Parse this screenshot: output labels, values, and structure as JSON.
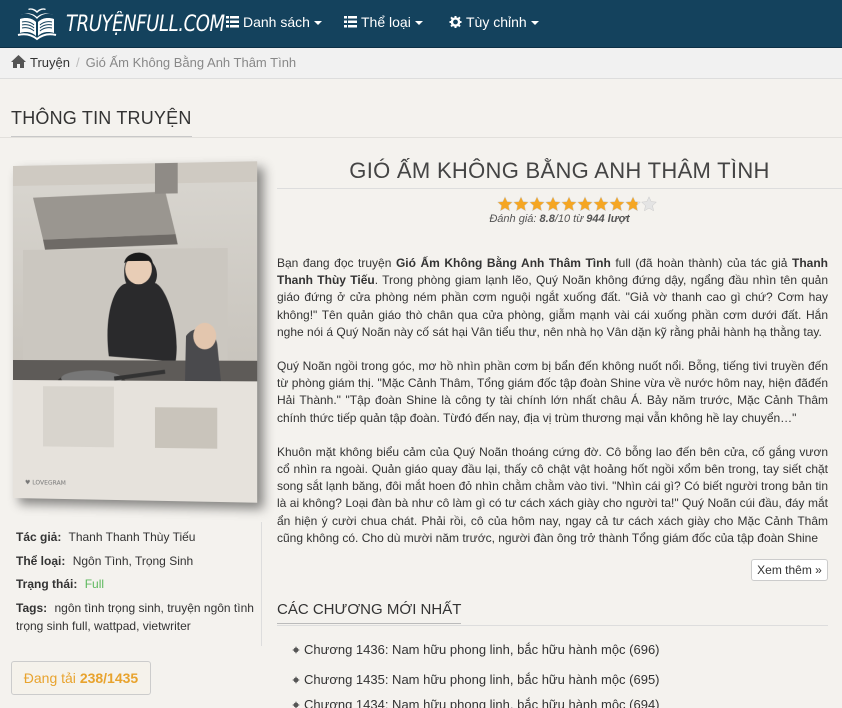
{
  "site": {
    "logo_text": "TRUYỆNFULL.COM"
  },
  "nav": {
    "items": [
      {
        "label": "Danh sách",
        "icon": "list-icon"
      },
      {
        "label": "Thể loại",
        "icon": "list-icon"
      },
      {
        "label": "Tùy chỉnh",
        "icon": "gear-icon"
      }
    ]
  },
  "breadcrumb": {
    "home": "Truyện",
    "current": "Gió Ấm Không Bằng Anh Thâm Tình"
  },
  "section": {
    "title": "THÔNG TIN TRUYỆN"
  },
  "story": {
    "title": "GIÓ ẤM KHÔNG BẰNG ANH THÂM TÌNH",
    "rating_prefix": "Đánh giá: ",
    "rating_value": "8.8",
    "rating_max": "/10",
    "rating_from": " từ ",
    "rating_count": "944 lượt",
    "stars_filled": 8.8,
    "stars_total": 10
  },
  "info": {
    "author_label": "Tác giả:",
    "author": "Thanh Thanh Thùy Tiếu",
    "genre_label": "Thể loại:",
    "genre": "Ngôn Tình, Trọng Sinh",
    "status_label": "Trạng thái:",
    "status": "Full",
    "tags_label": "Tags:",
    "tags": "ngôn tình trọng sinh, truyện ngôn tình trọng sinh full, wattpad, vietwriter",
    "posting_prefix": "Đang tải ",
    "posting_count": "238/1435"
  },
  "description": {
    "p1_a": "Bạn đang đọc truyện ",
    "p1_title": "Gió Ấm Không Bằng Anh Thâm Tình",
    "p1_b": " full (đã hoàn thành) của tác giả ",
    "p1_author": "Thanh Thanh Thùy Tiếu",
    "p1_c": ". Trong phòng giam lạnh lẽo, Quý Noãn không đứng dậy, ngẩng đầu nhìn tên quản giáo đứng ở cửa phòng ném phần cơm nguội ngắt xuống đất. \"Giả vờ thanh cao gì chứ? Cơm hay không!\" Tên quản giáo thò chân qua cửa phòng, giẫm mạnh vài cái xuống phần cơm dưới đất. Hắn nghe nói á Quý Noãn này cố sát hại Vân tiểu thư, nên nhà họ Vân dặn kỹ rằng phải hành hạ thằng tay.",
    "p2": "Quý Noãn ngồi trong góc, mơ hồ nhìn phần cơm bị bẩn đến không nuốt nổi. Bỗng, tiếng tivi truyền đến từ phòng giám thị. \"Mặc Cảnh Thâm, Tổng giám đốc tập đoàn Shine vừa về nước hôm nay, hiện đãđến Hải Thành.\" \"Tập đoàn Shine là công ty tài chính lớn nhất châu Á. Bảy năm trước, Mặc Cảnh Thâm chính thức tiếp quản tập đoàn. Từđó đến nay, địa vị trùm thương mại vẫn không hề lay chuyển…\"",
    "p3": "Khuôn mặt không biểu cảm của Quý Noãn thoáng cứng đờ. Cô bỗng lao đến bên cửa, cố gắng vươn cổ nhìn ra ngoài. Quản giáo quay đầu lại, thấy cô chật vật hoảng hốt ngồi xổm bên trong, tay siết chặt song sắt lạnh băng, đôi mắt hoen đỏ nhìn chằm chằm vào tivi. \"Nhìn cái gì? Có biết người trong bản tin là ai không? Loại đàn bà như cô làm gì có tư cách xách giày cho người ta!\" Quý Noãn cúi đầu, đáy mắt ẩn hiện ý cười chua chát. Phải rồi, cô của hôm nay, ngay cả tư cách xách giày cho Mặc Cảnh Thâm cũng không có. Cho dù mười năm trước, người đàn ông trở thành Tổng giám đốc của tập đoàn Shine",
    "more_label": "Xem thêm »"
  },
  "chapters": {
    "title": "CÁC CHƯƠNG MỚI NHẤT",
    "items": [
      "Chương 1436: Nam hữu phong linh, bắc hữu hành mộc (696)",
      "Chương 1435: Nam hữu phong linh, bắc hữu hành mộc (695)",
      "Chương 1434: Nam hữu phong linh, bắc hữu hành mộc (694)"
    ]
  },
  "colors": {
    "navbar": "#14425d",
    "status_green": "#5cb85c",
    "posting_orange": "#e8a32e",
    "star_gold": "#f5a623"
  }
}
